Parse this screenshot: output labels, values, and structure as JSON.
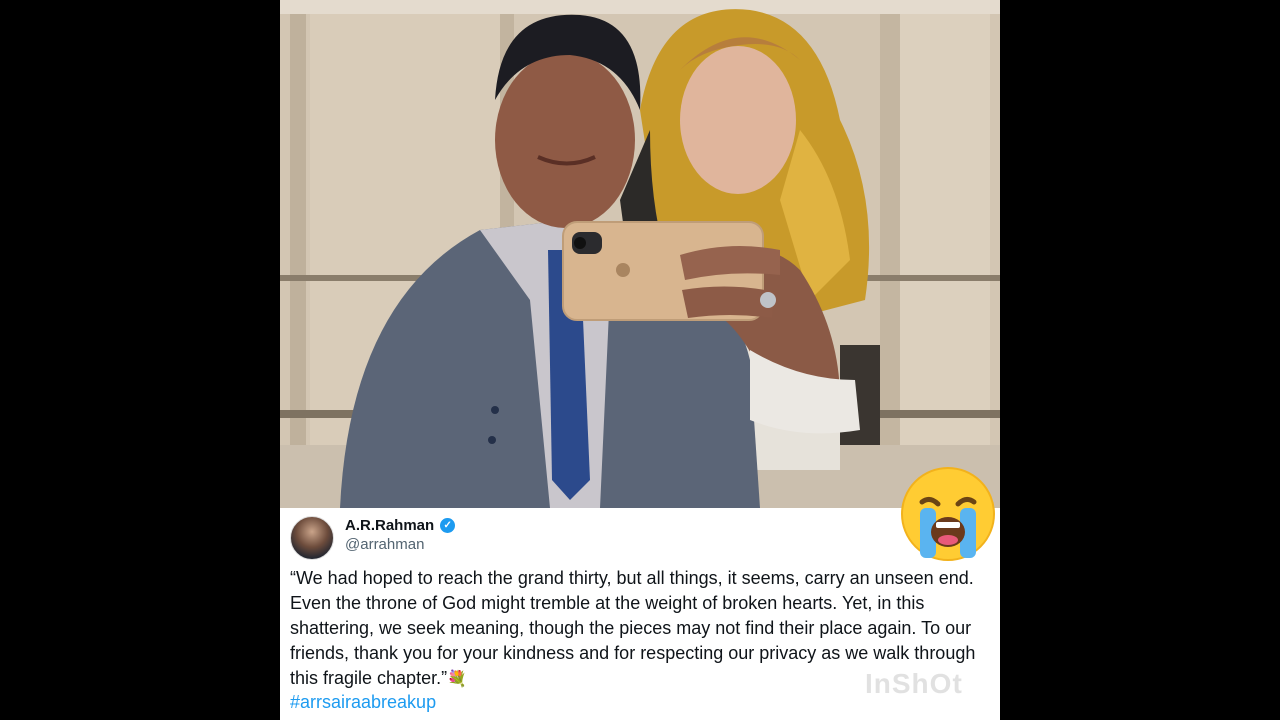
{
  "tweet": {
    "display_name": "A.R.Rahman",
    "handle": "@arrahman",
    "verified_icon": "verified-badge-icon",
    "text": "“We had hoped to reach the grand thirty, but all things, it seems, carry an unseen end. Even the throne of God might tremble at the weight of broken hearts. Yet, in this shattering, we seek meaning, though the pieces may not find their place again. To our friends, thank you for your kindness and for respecting our privacy as we walk through this fragile chapter.”",
    "flower_emoji": "💐",
    "hashtag": "#arrsairaabreakup"
  },
  "overlay": {
    "crying_emoji_icon": "loudly-crying-face-icon",
    "watermark": "InShOt"
  },
  "colors": {
    "background": "#000000",
    "link": "#1d9bf0",
    "verified": "#1d9bf0",
    "text": "#0f1419",
    "muted": "#536471"
  }
}
